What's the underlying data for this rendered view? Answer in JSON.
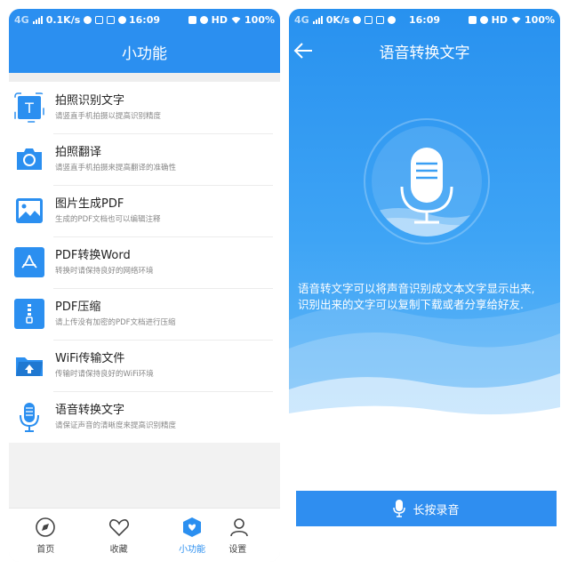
{
  "left": {
    "status": {
      "net": "0.1K/s",
      "time": "16:09",
      "hd": "HD",
      "battery": "100%"
    },
    "title": "小功能",
    "items": [
      {
        "title": "拍照识别文字",
        "subtitle": "请竖直手机拍摄以提高识别精度",
        "icon": "text-recognition-icon",
        "glyph": "T"
      },
      {
        "title": "拍照翻译",
        "subtitle": "请竖直手机拍摄来提高翻译的准确性",
        "icon": "camera-icon"
      },
      {
        "title": "图片生成PDF",
        "subtitle": "生成的PDF文档也可以编辑注释",
        "icon": "image-icon"
      },
      {
        "title": "PDF转换Word",
        "subtitle": "转换时请保持良好的网络环境",
        "icon": "pdf-icon"
      },
      {
        "title": "PDF压缩",
        "subtitle": "请上传没有加密的PDF文档进行压缩",
        "icon": "zip-icon"
      },
      {
        "title": "WiFi传输文件",
        "subtitle": "传输时请保持良好的WiFi环境",
        "icon": "folder-upload-icon"
      },
      {
        "title": "语音转换文字",
        "subtitle": "请保证声音的清晰度来提高识别精度",
        "icon": "microphone-icon"
      }
    ],
    "nav": [
      {
        "label": "首页",
        "icon": "compass-icon"
      },
      {
        "label": "收藏",
        "icon": "heart-icon"
      },
      {
        "label": "小功能",
        "icon": "shield-icon",
        "active": true
      },
      {
        "label": "设置",
        "icon": "user-icon"
      }
    ]
  },
  "right": {
    "status": {
      "net": "0K/s",
      "time": "16:09",
      "hd": "HD",
      "battery": "100%"
    },
    "title": "语音转换文字",
    "description_lines": [
      "语音转文字可以将声音识别成文本文字显示出来,",
      "识别出来的文字可以复制下载或者分享给好友."
    ],
    "record_button": "长按录音"
  },
  "colors": {
    "accent": "#2b8ff0",
    "hero_top": "#2891ef",
    "hero_bottom": "#64b9f8"
  }
}
